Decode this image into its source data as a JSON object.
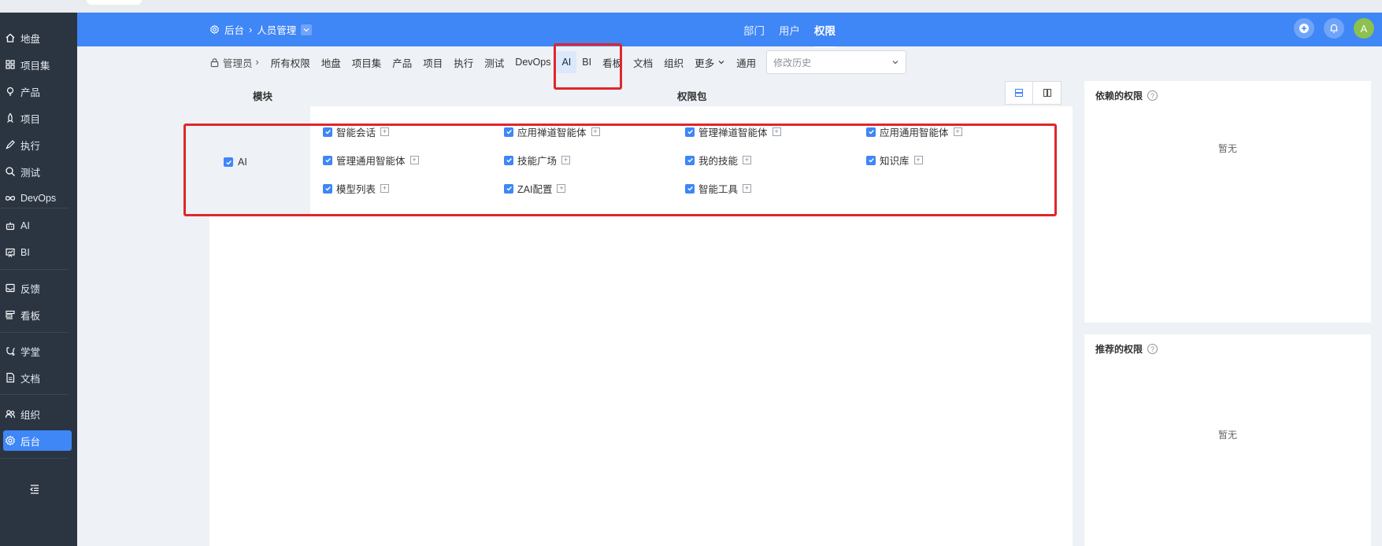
{
  "sidebar": {
    "items": [
      {
        "label": "地盘",
        "icon": "home-icon"
      },
      {
        "label": "项目集",
        "icon": "grid-icon"
      },
      {
        "label": "产品",
        "icon": "lightbulb-icon"
      },
      {
        "label": "项目",
        "icon": "rocket-icon"
      },
      {
        "label": "执行",
        "icon": "pen-icon"
      },
      {
        "label": "测试",
        "icon": "search-icon"
      },
      {
        "label": "DevOps",
        "icon": "infinity-icon"
      },
      {
        "label": "AI",
        "icon": "robot-icon"
      },
      {
        "label": "BI",
        "icon": "chart-board-icon"
      },
      {
        "label": "反馈",
        "icon": "inbox-icon"
      },
      {
        "label": "看板",
        "icon": "kanban-icon"
      },
      {
        "label": "学堂",
        "icon": "graduate-icon"
      },
      {
        "label": "文档",
        "icon": "doc-icon"
      },
      {
        "label": "组织",
        "icon": "users-icon"
      },
      {
        "label": "后台",
        "icon": "gear-icon"
      }
    ],
    "active": "后台"
  },
  "header": {
    "breadcrumb_root": "后台",
    "breadcrumb_current": "人员管理",
    "tabs": [
      "部门",
      "用户",
      "权限"
    ],
    "active_tab": "权限",
    "avatar_letter": "A"
  },
  "subnav": {
    "admin_label": "管理员",
    "items": [
      "所有权限",
      "地盘",
      "项目集",
      "产品",
      "项目",
      "执行",
      "测试",
      "DevOps",
      "AI",
      "BI",
      "看板",
      "文档",
      "组织",
      "更多",
      "通用"
    ],
    "active": "AI",
    "history_placeholder": "修改历史"
  },
  "table": {
    "col_module": "模块",
    "col_package": "权限包",
    "module_name": "AI",
    "permissions": [
      "智能会话",
      "应用禅道智能体",
      "管理禅道智能体",
      "应用通用智能体",
      "管理通用智能体",
      "技能广场",
      "我的技能",
      "知识库",
      "模型列表",
      "ZAI配置",
      "智能工具"
    ]
  },
  "panels": {
    "depend_title": "依赖的权限",
    "depend_empty": "暂无",
    "recommend_title": "推荐的权限",
    "recommend_empty": "暂无"
  },
  "colors": {
    "primary": "#3f86f6",
    "sidebar_bg": "#2b3542",
    "annotation": "#e0262b"
  }
}
